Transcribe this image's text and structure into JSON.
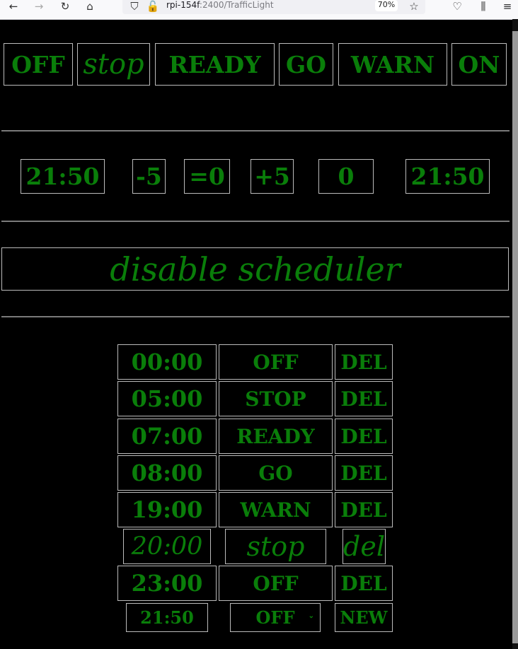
{
  "browser": {
    "url_host": "rpi-154f",
    "url_rest": ":2400/TrafficLight",
    "zoom": "70%"
  },
  "modes": [
    "OFF",
    "stop",
    "READY",
    "GO",
    "WARN",
    "ON"
  ],
  "time_controls": {
    "current_time": "21:50",
    "minus": "-5",
    "reset": "=0",
    "plus": "+5",
    "offset": "0",
    "adjusted_time": "21:50"
  },
  "scheduler_toggle": "disable scheduler",
  "schedule": [
    {
      "time": "00:00",
      "state": "OFF",
      "action": "DEL"
    },
    {
      "time": "05:00",
      "state": "STOP",
      "action": "DEL"
    },
    {
      "time": "07:00",
      "state": "READY",
      "action": "DEL"
    },
    {
      "time": "08:00",
      "state": "GO",
      "action": "DEL"
    },
    {
      "time": "19:00",
      "state": "WARN",
      "action": "DEL"
    },
    {
      "time": "20:00",
      "state": "stop",
      "action": "del"
    },
    {
      "time": "23:00",
      "state": "OFF",
      "action": "DEL"
    }
  ],
  "new_entry": {
    "time": "21:50",
    "state": "OFF",
    "action": "NEW"
  },
  "colors": {
    "text": "#0a7e0a",
    "background": "#000000",
    "border": "#bbbbbb"
  }
}
